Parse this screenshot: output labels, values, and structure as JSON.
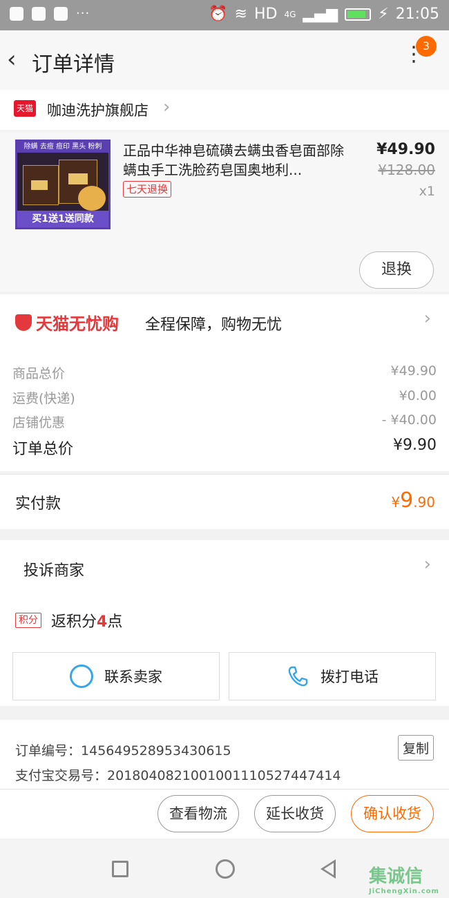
{
  "status_bar": {
    "network": "HD",
    "signal": "4G",
    "time": "21:05",
    "dots": "···"
  },
  "header": {
    "title": "订单详情",
    "badge_count": "3"
  },
  "shop": {
    "logo_text": "天猫",
    "name": "咖迪洗护旗舰店"
  },
  "product": {
    "thumb_top_text": "除螨 去痘 痘印 黑头 粉刺",
    "thumb_bottom_text": "买1送1送同款",
    "title": "正品中华神皂硫磺去螨虫香皂面部除螨虫手工洗脸药皂国奥地利...",
    "refund_tag": "七天退换",
    "price": "¥49.90",
    "original_price": "¥128.00",
    "quantity": "x1",
    "refund_button": "退换"
  },
  "guarantee": {
    "brand": "天猫无忧购",
    "text": "全程保障，购物无忧"
  },
  "totals": {
    "goods_label": "商品总价",
    "goods_value": "¥49.90",
    "shipping_label": "运费(快递)",
    "shipping_value": "¥0.00",
    "discount_label": "店铺优惠",
    "discount_value": "- ¥40.00",
    "order_total_label": "订单总价",
    "order_total_value": "¥9.90",
    "paid_label": "实付款",
    "paid_currency": "¥",
    "paid_int": "9",
    "paid_dec": ".90"
  },
  "complaint": {
    "label": "投诉商家"
  },
  "points": {
    "tag": "积分",
    "prefix": "返积分",
    "number": "4",
    "suffix": "点"
  },
  "contact": {
    "seller_label": "联系卖家",
    "phone_label": "拨打电话"
  },
  "order_info": {
    "order_no_label": "订单编号：",
    "order_no": "145649528953430615",
    "alipay_label": "支付宝交易号：",
    "alipay_no": "2018040821001001110527447414",
    "copy_label": "复制"
  },
  "actions": {
    "logistics": "查看物流",
    "extend": "延长收货",
    "confirm": "确认收货"
  },
  "watermark": {
    "text": "集诚信",
    "url": "JiChengXin.com"
  },
  "colors": {
    "accent": "#ff6a00",
    "tmall_red": "#e4393c",
    "icon_blue": "#36a6e8"
  }
}
